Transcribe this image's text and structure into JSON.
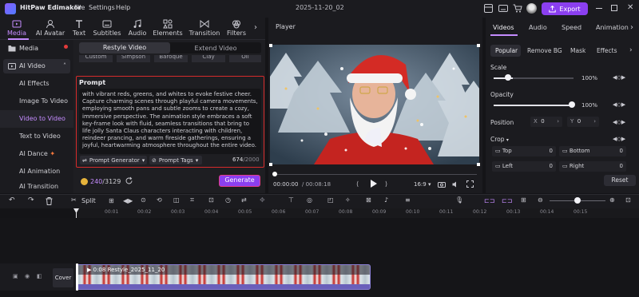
{
  "app": {
    "name": "HitPaw Edimakor",
    "menu": [
      "File",
      "Settings",
      "Help"
    ],
    "doc_title": "2025-11-20_02",
    "export": "Export"
  },
  "tabs": [
    {
      "label": "Media",
      "icon": "media-icon"
    },
    {
      "label": "AI Avatar",
      "icon": "ai-avatar-icon"
    },
    {
      "label": "Text",
      "icon": "text-icon"
    },
    {
      "label": "Subtitles",
      "icon": "subtitles-icon"
    },
    {
      "label": "Audio",
      "icon": "audio-icon"
    },
    {
      "label": "Elements",
      "icon": "elements-icon"
    },
    {
      "label": "Transition",
      "icon": "transition-icon"
    },
    {
      "label": "Filters",
      "icon": "filters-icon"
    }
  ],
  "sidebar": {
    "groups": [
      "Media",
      "AI Video"
    ],
    "items": [
      "AI Effects",
      "Image To Video",
      "Video to Video",
      "Text to Video",
      "AI Dance",
      "AI Animation",
      "AI Transition"
    ]
  },
  "panel": {
    "mode_tabs": [
      "Restyle Video",
      "Extend Video"
    ],
    "styles": [
      "Custom",
      "Simpson",
      "Baroque",
      "Clay",
      "Oil"
    ],
    "prompt_label": "Prompt",
    "prompt_text": "with vibrant reds, greens, and whites to evoke festive cheer. Capture charming scenes through playful camera movements, employing smooth pans and subtle zooms to create a cozy, immersive perspective. The animation style embraces a soft key-frame look with fluid, seamless transitions that bring to life jolly Santa Claus characters interacting with children, reindeer prancing, and warm fireside gatherings, ensuring a joyful, heartwarming atmosphere throughout the entire video.",
    "prompt_generator": "Prompt Generator",
    "prompt_tags": "Prompt Tags",
    "char_count": "674",
    "char_limit": "/2000",
    "credits_used": "240",
    "credits_total": "/3129",
    "generate": "Generate"
  },
  "player": {
    "title": "Player",
    "current_time": "00:00:00",
    "total_time": "/ 00:08:18",
    "aspect": "16:9"
  },
  "right": {
    "tabs": [
      "Videos",
      "Audio",
      "Speed",
      "Animation"
    ],
    "subtabs": [
      "Popular",
      "Remove BG",
      "Mask",
      "Effects"
    ],
    "scale_label": "Scale",
    "scale_value": "100%",
    "scale_level": 1.0,
    "opacity_label": "Opacity",
    "opacity_value": "100%",
    "opacity_level": 1.0,
    "position_label": "Position",
    "pos_x_label": "X",
    "pos_x": "0",
    "pos_y_label": "Y",
    "pos_y": "0",
    "crop_label": "Crop",
    "crop_top": "Top",
    "crop_bottom": "Bottom",
    "crop_left": "Left",
    "crop_right": "Right",
    "crop_top_v": "0",
    "crop_bottom_v": "0",
    "crop_left_v": "0",
    "crop_right_v": "0",
    "reset": "Reset"
  },
  "timeline": {
    "split": "Split",
    "ticks": [
      "00:00",
      "00:01",
      "00:02",
      "00:03",
      "00:04",
      "00:05",
      "00:06",
      "00:07",
      "00:08",
      "00:09",
      "00:10",
      "00:11",
      "00:12",
      "00:13",
      "00:14",
      "00:15"
    ],
    "cover": "Cover",
    "clip_label": "0:08 Restyle_2025_11_20"
  },
  "colors": {
    "accent": "#8b3ff0",
    "accent_text": "#c58cff",
    "prompt_border": "#d62b2b",
    "clip_bg": "#5b4fa3"
  }
}
